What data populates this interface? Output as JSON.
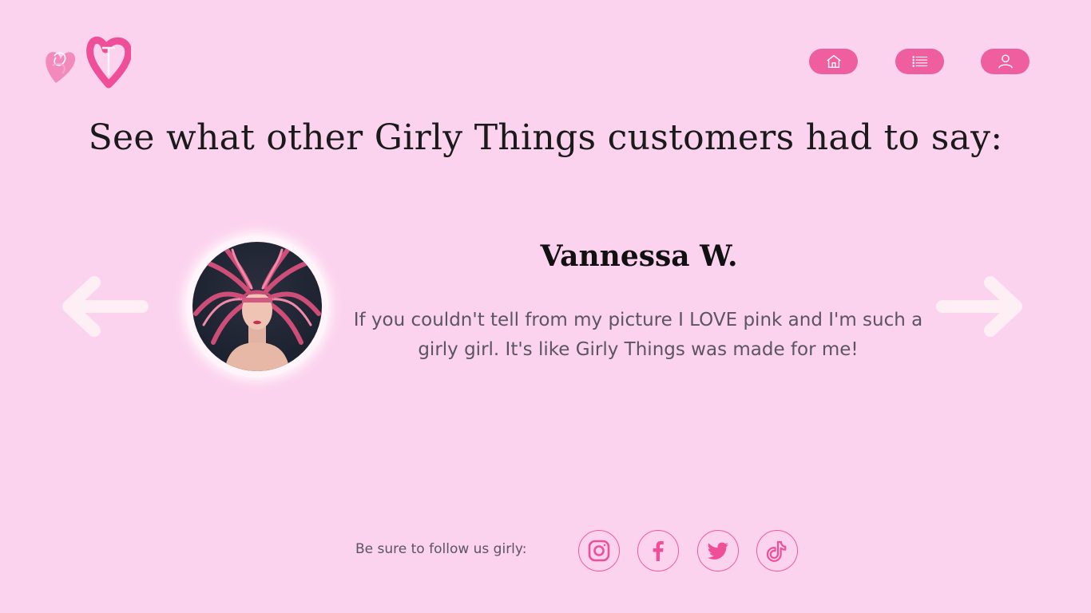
{
  "header": {
    "logo_icon": "heart-logo-icon",
    "nav": [
      {
        "icon": "home-icon"
      },
      {
        "icon": "menu-list-icon"
      },
      {
        "icon": "user-icon"
      }
    ]
  },
  "main": {
    "headline": "See what other Girly Things customers had to say:",
    "testimonial": {
      "name": "Vannessa W.",
      "quote": "If you couldn't tell from my picture I LOVE pink and I'm such a girly girl. It's like Girly Things was made for me!",
      "avatar_icon": "customer-photo"
    },
    "prev_icon": "arrow-left-icon",
    "next_icon": "arrow-right-icon"
  },
  "footer": {
    "follow_label": "Be sure to follow us girly:",
    "socials": [
      {
        "icon": "instagram-icon"
      },
      {
        "icon": "facebook-icon"
      },
      {
        "icon": "twitter-icon"
      },
      {
        "icon": "tiktok-icon"
      }
    ]
  },
  "colors": {
    "background": "#fcd3ee",
    "accent": "#ef5e9e",
    "arrow": "#fdeff3",
    "text_dark": "#1a1a1a",
    "text_muted": "#5a5560"
  }
}
